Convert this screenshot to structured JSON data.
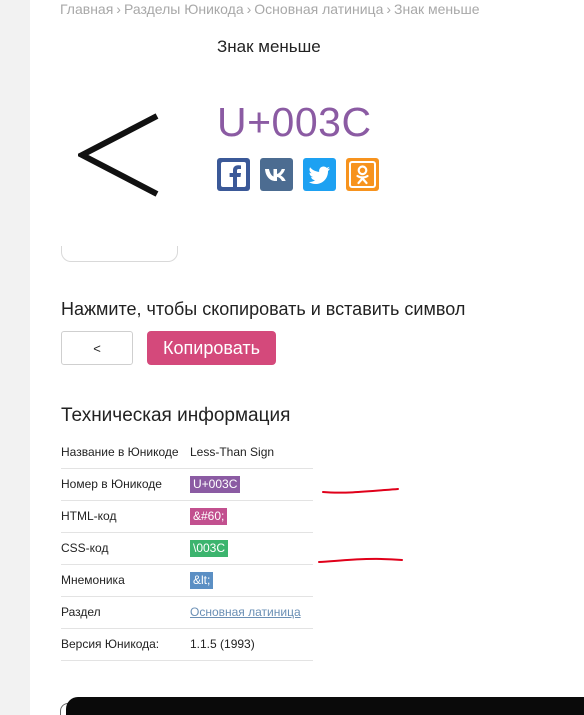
{
  "breadcrumb": {
    "items": [
      "Главная",
      "Разделы Юникода",
      "Основная латиница",
      "Знак меньше"
    ],
    "separator": "›"
  },
  "character": {
    "name": "Знак меньше",
    "glyph": "<",
    "codepoint": "U+003C"
  },
  "share": {
    "icons": [
      "facebook-icon",
      "vk-icon",
      "twitter-icon",
      "odnoklassniki-icon"
    ],
    "colors": {
      "facebook": "#3b5998",
      "vk": "#4c6c91",
      "twitter": "#1da1f2",
      "odnoklassniki": "#f7931e"
    }
  },
  "copy": {
    "title": "Нажмите, чтобы скопировать и вставить символ",
    "field_value": "<",
    "button_label": "Копировать",
    "button_color": "#d4497b"
  },
  "tech": {
    "title": "Техническая информация",
    "rows": [
      {
        "label": "Название в Юникоде",
        "value": "Less-Than Sign"
      },
      {
        "label": "Номер в Юникоде",
        "value": "U+003C"
      },
      {
        "label": "HTML-код",
        "value": "&#60;"
      },
      {
        "label": "CSS-код",
        "value": "\\003C"
      },
      {
        "label": "Мнемоника",
        "value": "&lt;"
      },
      {
        "label": "Раздел",
        "value": "Основная латиница"
      },
      {
        "label": "Версия Юникода:",
        "value": "1.1.5 (1993)"
      }
    ]
  },
  "annotation_color": "#e0001a"
}
